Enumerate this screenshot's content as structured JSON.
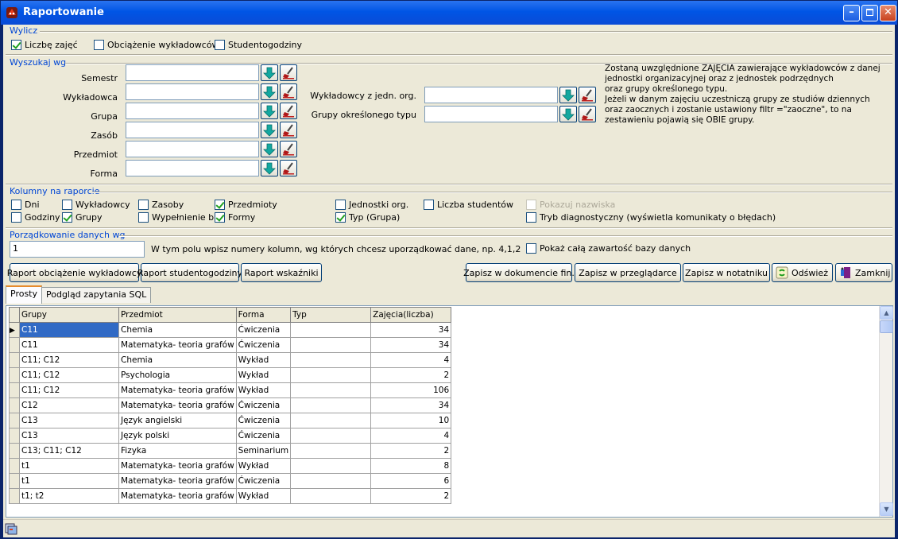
{
  "window": {
    "title": "Raportowanie"
  },
  "wylicz": {
    "title": "Wylicz",
    "options": [
      {
        "label": "Liczbę zajęć",
        "checked": true
      },
      {
        "label": "Obciążenie wykładowców",
        "checked": false
      },
      {
        "label": "Studentogodziny",
        "checked": false
      }
    ]
  },
  "wyszukaj": {
    "title": "Wyszukaj wg",
    "left_fields": [
      {
        "label": "Semestr",
        "value": ""
      },
      {
        "label": "Wykładowca",
        "value": ""
      },
      {
        "label": "Grupa",
        "value": ""
      },
      {
        "label": "Zasób",
        "value": ""
      },
      {
        "label": "Przedmiot",
        "value": ""
      },
      {
        "label": "Forma",
        "value": ""
      }
    ],
    "right_fields": [
      {
        "label": "Wykładowcy z jedn. org.",
        "value": ""
      },
      {
        "label": "Grupy określonego typu",
        "value": ""
      }
    ],
    "info_lines": [
      "Zostaną uwzględnione ZAJĘCIA zawierające wykładowców z danej",
      "jednostki organizacyjnej  oraz z jednostek podrzędnych",
      "oraz grupy określonego typu.",
      "Jeżeli w danym zajęciu uczestniczą grupy ze studiów dziennych",
      "oraz zaocznych i zostanie ustawiony filtr =\"zaoczne\", to na",
      "zestawieniu pojawią się OBIE grupy."
    ]
  },
  "kolumny": {
    "title": "Kolumny na raporcie",
    "options": [
      {
        "label": "Dni",
        "checked": false,
        "disabled": false
      },
      {
        "label": "Godziny",
        "checked": false,
        "disabled": false
      },
      {
        "label": "Wykładowcy",
        "checked": false,
        "disabled": false
      },
      {
        "label": "Grupy",
        "checked": true,
        "disabled": false
      },
      {
        "label": "Zasoby",
        "checked": false,
        "disabled": false
      },
      {
        "label": "Wypełnienie bl.",
        "checked": false,
        "disabled": false
      },
      {
        "label": "Przedmioty",
        "checked": true,
        "disabled": false
      },
      {
        "label": "Formy",
        "checked": true,
        "disabled": false
      },
      {
        "label": "Jednostki org.",
        "checked": false,
        "disabled": false
      },
      {
        "label": "Typ (Grupa)",
        "checked": true,
        "disabled": false
      },
      {
        "label": "Liczba studentów",
        "checked": false,
        "disabled": false
      },
      {
        "label": "Pokazuj nazwiska",
        "checked": false,
        "disabled": true
      },
      {
        "label": "Tryb diagnostyczny (wyświetla komunikaty o błędach)",
        "checked": false,
        "disabled": false
      }
    ]
  },
  "porzadkowanie": {
    "title": "Porządkowanie danych wg",
    "value": "1",
    "hint": "W tym polu wpisz numery kolumn, wg których chcesz uporządkować dane, np. 4,1,2",
    "show_all": {
      "label": "Pokaż całą zawartość bazy danych",
      "checked": false
    }
  },
  "buttons": {
    "raport_obciazenie": "Raport obciążenie wykładowcy",
    "raport_studentogodziny": "Raport studentogodziny",
    "raport_wskazniki": "Raport wskaźniki",
    "zapisz_dokument": "Zapisz w dokumencie fin.",
    "zapisz_przegladarce": "Zapisz w przeglądarce",
    "zapisz_notatniku": "Zapisz w notatniku",
    "odswiez": "Odśwież",
    "zamknij": "Zamknij"
  },
  "tabs": [
    {
      "label": "Prosty",
      "active": true
    },
    {
      "label": "Podgląd zapytania SQL",
      "active": false
    }
  ],
  "grid": {
    "columns": [
      "Grupy",
      "Przedmiot",
      "Forma",
      "Typ",
      "Zajęcia(liczba)"
    ],
    "rows": [
      [
        "C11",
        "Chemia",
        "Ćwiczenia",
        "",
        "34"
      ],
      [
        "C11",
        "Matematyka- teoria grafów",
        "Ćwiczenia",
        "",
        "34"
      ],
      [
        "C11; C12",
        "Chemia",
        "Wykład",
        "",
        "4"
      ],
      [
        "C11; C12",
        "Psychologia",
        "Wykład",
        "",
        "2"
      ],
      [
        "C11; C12",
        "Matematyka- teoria grafów",
        "Wykład",
        "",
        "106"
      ],
      [
        "C12",
        "Matematyka- teoria grafów",
        "Ćwiczenia",
        "",
        "34"
      ],
      [
        "C13",
        "Język angielski",
        "Ćwiczenia",
        "",
        "10"
      ],
      [
        "C13",
        "Język polski",
        "Ćwiczenia",
        "",
        "4"
      ],
      [
        "C13; C11; C12",
        "Fizyka",
        "Seminarium",
        "",
        "2"
      ],
      [
        "t1",
        "Matematyka- teoria grafów",
        "Wykład",
        "",
        "8"
      ],
      [
        "t1",
        "Matematyka- teoria grafów",
        "Ćwiczenia",
        "",
        "6"
      ],
      [
        "t1; t2",
        "Matematyka- teoria grafów",
        "Wykład",
        "",
        "2"
      ]
    ],
    "selected_row": 0
  }
}
